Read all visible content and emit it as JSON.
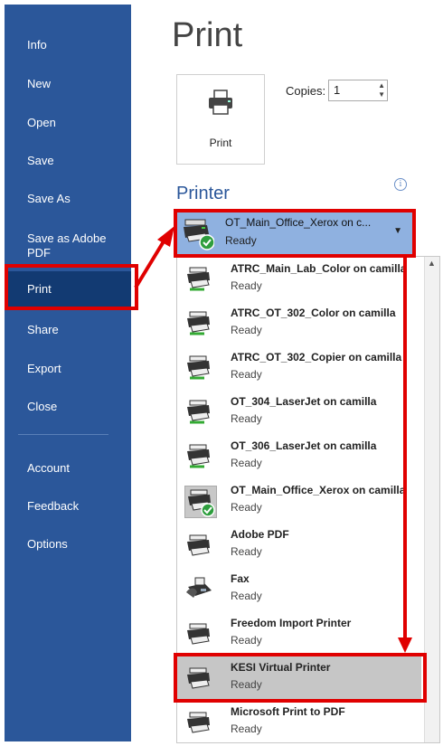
{
  "sidebar": {
    "items": [
      {
        "label": "Info"
      },
      {
        "label": "New"
      },
      {
        "label": "Open"
      },
      {
        "label": "Save"
      },
      {
        "label": "Save As"
      },
      {
        "label": "Save as Adobe PDF"
      },
      {
        "label": "Print"
      },
      {
        "label": "Share"
      },
      {
        "label": "Export"
      },
      {
        "label": "Close"
      },
      {
        "label": "Account"
      },
      {
        "label": "Feedback"
      },
      {
        "label": "Options"
      }
    ]
  },
  "page": {
    "title": "Print"
  },
  "print_button": {
    "label": "Print",
    "icon": "printer-icon"
  },
  "copies": {
    "label": "Copies:",
    "value": "1"
  },
  "printer_section": {
    "title": "Printer",
    "info_icon": "i",
    "selected": {
      "name": "OT_Main_Office_Xerox on c...",
      "status": "Ready"
    },
    "dropdown_arrow": "▼",
    "printers": [
      {
        "name": "ATRC_Main_Lab_Color on camilla",
        "status": "Ready",
        "icon": "network-printer-icon"
      },
      {
        "name": "ATRC_OT_302_Color on camilla",
        "status": "Ready",
        "icon": "network-printer-icon"
      },
      {
        "name": "ATRC_OT_302_Copier on camilla",
        "status": "Ready",
        "icon": "network-printer-icon"
      },
      {
        "name": "OT_304_LaserJet on camilla",
        "status": "Ready",
        "icon": "network-printer-icon"
      },
      {
        "name": "OT_306_LaserJet on camilla",
        "status": "Ready",
        "icon": "network-printer-icon"
      },
      {
        "name": "OT_Main_Office_Xerox on camilla",
        "status": "Ready",
        "icon": "default-printer-icon"
      },
      {
        "name": "Adobe PDF",
        "status": "Ready",
        "icon": "printer-icon"
      },
      {
        "name": "Fax",
        "status": "Ready",
        "icon": "fax-icon"
      },
      {
        "name": "Freedom Import Printer",
        "status": "Ready",
        "icon": "printer-icon"
      },
      {
        "name": "KESI Virtual Printer",
        "status": "Ready",
        "icon": "printer-icon"
      },
      {
        "name": "Microsoft Print to PDF",
        "status": "Ready",
        "icon": "printer-icon"
      }
    ]
  },
  "colors": {
    "sidebar": "#2b579a",
    "sidebar_active": "#123a72",
    "accent": "#2b579a",
    "selected_printer": "#8fb1e0",
    "highlight": "#e00000"
  }
}
